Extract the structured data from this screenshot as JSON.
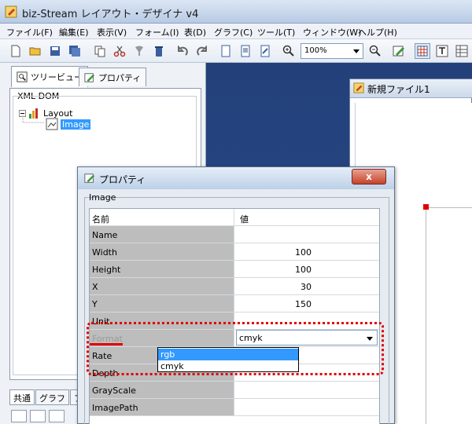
{
  "app": {
    "title": "biz-Stream レイアウト・デザイナ v4"
  },
  "menu": [
    "ファイル(F)",
    "編集(E)",
    "表示(V)",
    "フォーム(I)",
    "表(D)",
    "グラフ(C)",
    "ツール(T)",
    "ウィンドウ(W)",
    "ヘルプ(H)"
  ],
  "toolbar": {
    "zoom_value": "100%"
  },
  "left_tabs": {
    "tree": "ツリービュー",
    "props": "プロパティ"
  },
  "tree": {
    "group_label": "XML DOM",
    "root": "Layout",
    "child": "Image"
  },
  "bottom_tabs": [
    "共通",
    "グラフ",
    "フ"
  ],
  "document": {
    "title": "新規ファイル1"
  },
  "dialog": {
    "title": "プロパティ",
    "close_label": "x",
    "group_label": "Image",
    "header": {
      "name": "名前",
      "value": "値"
    },
    "rows": [
      {
        "name": "Name",
        "value": ""
      },
      {
        "name": "Width",
        "value": "100"
      },
      {
        "name": "Height",
        "value": "100"
      },
      {
        "name": "X",
        "value": "30"
      },
      {
        "name": "Y",
        "value": "150"
      },
      {
        "name": "Unit",
        "value": ""
      },
      {
        "name": "Format",
        "value": "cmyk"
      },
      {
        "name": "Rate",
        "value": ""
      },
      {
        "name": "Depth",
        "value": ""
      },
      {
        "name": "GrayScale",
        "value": ""
      },
      {
        "name": "ImagePath",
        "value": ""
      }
    ],
    "format_options": [
      "rgb",
      "cmyk"
    ],
    "format_highlighted": "rgb"
  },
  "colors": {
    "workspace": "#2a4e8c",
    "highlight": "#3399ff",
    "annotation": "#e00000"
  }
}
